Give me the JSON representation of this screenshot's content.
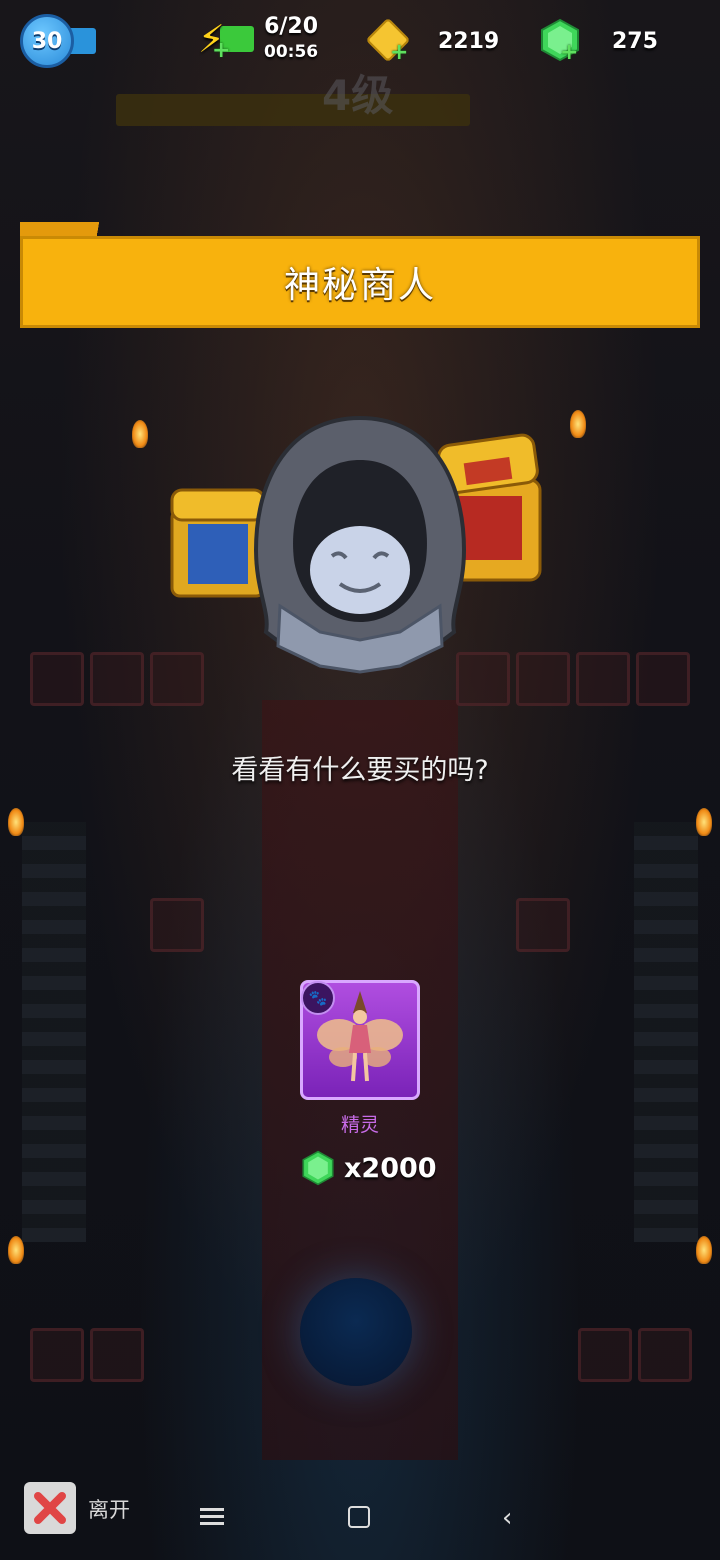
{
  "hud": {
    "player_level": "30",
    "energy": "6/20",
    "energy_timer": "00:56",
    "gold": "2219",
    "gems": "275",
    "background_level": "4级"
  },
  "merchant": {
    "title": "神秘商人",
    "prompt": "看看有什么要买的吗?"
  },
  "offer": {
    "item_name": "精灵",
    "category_icon": "paw-icon",
    "price": "x2000",
    "currency_icon": "gem-icon"
  },
  "footer": {
    "leave_label": "离开"
  },
  "colors": {
    "banner": "#f8b20d",
    "card": "#9b3fd6",
    "item_name": "#c86ce8",
    "gem": "#3fd65a"
  }
}
